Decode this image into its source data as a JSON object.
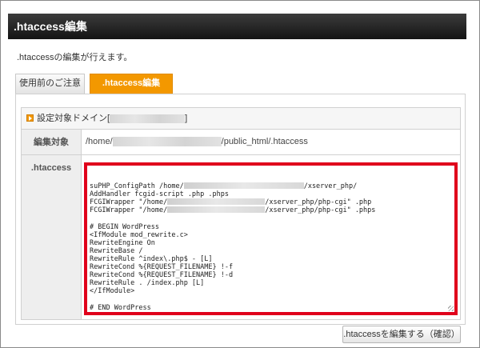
{
  "header": {
    "title": ".htaccess編集"
  },
  "description": ".htaccessの編集が行えます。",
  "tabs": [
    {
      "label": "使用前のご注意",
      "active": false
    },
    {
      "label": ".htaccess編集",
      "active": true
    }
  ],
  "domain": {
    "label_prefix": "設定対象ドメイン[",
    "label_suffix": "]"
  },
  "form": {
    "target_label": "編集対象",
    "path_prefix": "/home/",
    "path_suffix": "/public_html/.htaccess",
    "htaccess_label": ".htaccess"
  },
  "editor": {
    "lines": [
      {
        "a": "suPHP_ConfigPath /home/",
        "b": "/xserver_php/"
      },
      {
        "a": "AddHandler fcgid-script .php .phps"
      },
      {
        "a": "FCGIWrapper \"/home/",
        "b": "/xserver_php/php-cgi\" .php"
      },
      {
        "a": "FCGIWrapper \"/home/",
        "b": "/xserver_php/php-cgi\" .phps"
      },
      {
        "a": ""
      },
      {
        "a": "# BEGIN WordPress"
      },
      {
        "a": "<IfModule mod_rewrite.c>"
      },
      {
        "a": "RewriteEngine On"
      },
      {
        "a": "RewriteBase /"
      },
      {
        "a": "RewriteRule ^index\\.php$ - [L]"
      },
      {
        "a": "RewriteCond %{REQUEST_FILENAME} !-f"
      },
      {
        "a": "RewriteCond %{REQUEST_FILENAME} !-d"
      },
      {
        "a": "RewriteRule . /index.php [L]"
      },
      {
        "a": "</IfModule>"
      },
      {
        "a": ""
      },
      {
        "a": "# END WordPress"
      }
    ]
  },
  "buttons": {
    "confirm_label": ".htaccessを編集する（確認）"
  },
  "colors": {
    "accent": "#f39800",
    "highlight": "#e0001b"
  }
}
